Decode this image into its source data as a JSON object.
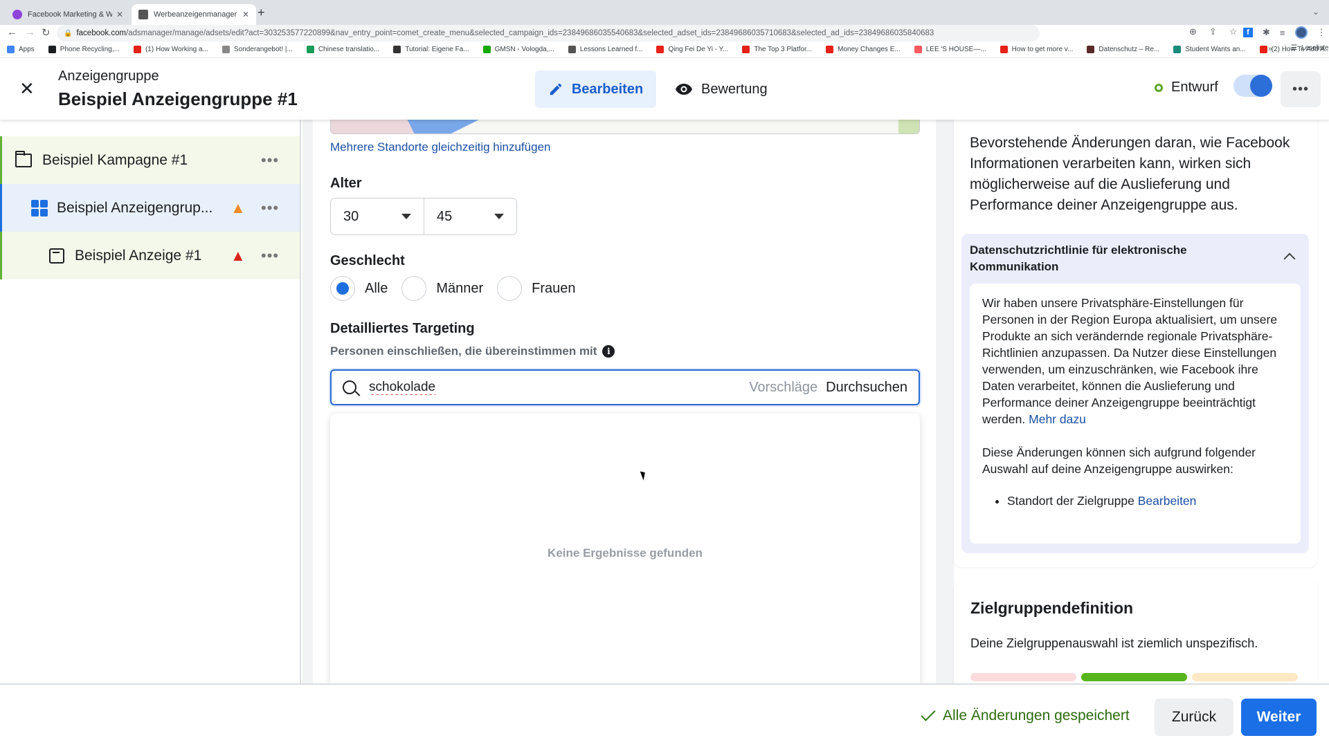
{
  "browser": {
    "tabs": [
      {
        "title": "Facebook Marketing & Werbea",
        "favicon_color": "#8e44d9",
        "active": false
      },
      {
        "title": "Werbeanzeigenmanager - Wer",
        "favicon_color": "#555555",
        "active": true
      }
    ],
    "new_tab_icon": "+",
    "url_host": "facebook.com",
    "url_path": "/adsmanager/manage/adsets/edit?act=303253577220899&nav_entry_point=comet_create_menu&selected_campaign_ids=23849686035540683&selected_adset_ids=23849686035710683&selected_ad_ids=23849686035840683",
    "bookmarks": [
      {
        "label": "Apps",
        "icon_color": "#4285f4"
      },
      {
        "label": "Phone Recycling,...",
        "icon_color": "#1c1e21"
      },
      {
        "label": "(1) How Working a...",
        "icon_color": "#e62117"
      },
      {
        "label": "Sonderangebot! |...",
        "icon_color": "#888888"
      },
      {
        "label": "Chinese translatio...",
        "icon_color": "#1a9c5a"
      },
      {
        "label": "Tutorial: Eigene Fa...",
        "icon_color": "#333333"
      },
      {
        "label": "GMSN - Vologda,...",
        "icon_color": "#14a800"
      },
      {
        "label": "Lessons Learned f...",
        "icon_color": "#555555"
      },
      {
        "label": "Qing Fei De Yi - Y...",
        "icon_color": "#e62117"
      },
      {
        "label": "The Top 3 Platfor...",
        "icon_color": "#e62117"
      },
      {
        "label": "Money Changes E...",
        "icon_color": "#e62117"
      },
      {
        "label": "LEE 'S HOUSE—...",
        "icon_color": "#ff5a5f"
      },
      {
        "label": "How to get more v...",
        "icon_color": "#e62117"
      },
      {
        "label": "Datenschutz – Re...",
        "icon_color": "#5a2a2a"
      },
      {
        "label": "Student Wants an...",
        "icon_color": "#1a8a7a"
      },
      {
        "label": "(2) How To Add A...",
        "icon_color": "#e62117"
      }
    ],
    "bookmarks_more": "»",
    "reading_list": "Leseliste"
  },
  "header": {
    "subtitle": "Anzeigengruppe",
    "title": "Beispiel Anzeigengruppe #1",
    "edit_label": "Bearbeiten",
    "review_label": "Bewertung",
    "status_label": "Entwurf",
    "toggle_on": true,
    "more_label": "•••"
  },
  "sidebar": {
    "items": [
      {
        "label": "Beispiel Kampagne #1",
        "type": "campaign",
        "warning": null
      },
      {
        "label": "Beispiel Anzeigengrup...",
        "type": "adset",
        "warning": "orange",
        "selected": true
      },
      {
        "label": "Beispiel Anzeige #1",
        "type": "ad",
        "warning": "red"
      }
    ],
    "more_label": "•••"
  },
  "main": {
    "add_locations_link": "Mehrere Standorte gleichzeitig hinzufügen",
    "age": {
      "heading": "Alter",
      "min": "30",
      "max": "45"
    },
    "gender": {
      "heading": "Geschlecht",
      "options": [
        "Alle",
        "Männer",
        "Frauen"
      ],
      "selected": "Alle"
    },
    "targeting": {
      "heading": "Detailliertes Targeting",
      "subtext": "Personen einschließen, die übereinstimmen mit",
      "search_value": "schokolade",
      "suggestions_label": "Vorschläge",
      "browse_label": "Durchsuchen",
      "no_results": "Keine Ergebnisse gefunden"
    }
  },
  "right_panel": {
    "intro": "Bevorstehende Änderungen daran, wie Facebook Informationen verarbeiten kann, wirken sich möglicherweise auf die Auslieferung und Performance deiner Anzeigengruppe aus.",
    "accordion_title": "Datenschutzrichtlinie für elektronische Kommunikation",
    "accordion_p1": "Wir haben unsere Privatsphäre-Einstellungen für Personen in der Region Europa aktualisiert, um unsere Produkte an sich verändernde regionale Privatsphäre-Richtlinien anzupassen. Da Nutzer diese Einstellungen verwenden, um einzuschränken, wie Facebook ihre Daten verarbeitet, können die Auslieferung und Performance deiner Anzeigengruppe beeinträchtigt werden.",
    "learn_more": "Mehr dazu",
    "accordion_p2": "Diese Änderungen können sich aufgrund folgender Auswahl auf deine Anzeigengruppe auswirken:",
    "bullet_text": "Standort der Zielgruppe",
    "bullet_link": "Bearbeiten",
    "audience": {
      "title": "Zielgruppendefinition",
      "text": "Deine Zielgruppenauswahl ist ziemlich unspezifisch.",
      "meter_segments": [
        "#fbdbdc",
        "#58b41d",
        "#fde8c4"
      ],
      "meter_active_segment": 2
    }
  },
  "footer": {
    "saved_text": "Alle Änderungen gespeichert",
    "back_label": "Zurück",
    "next_label": "Weiter"
  },
  "colors": {
    "accent": "#1b6fe6",
    "success": "#58b41d",
    "warning_orange": "#f08a24",
    "warning_red": "#d8261b"
  }
}
